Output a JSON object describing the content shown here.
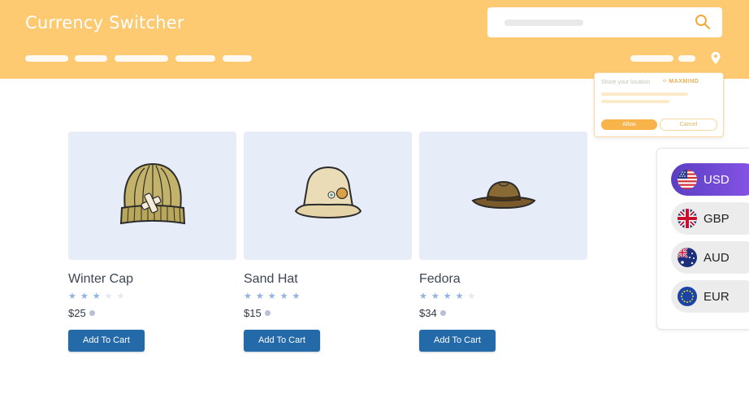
{
  "header": {
    "title": "Currency Switcher",
    "search": {
      "placeholder": ""
    }
  },
  "location_prompt": {
    "text": "Share your location",
    "provider": "MAXMIND",
    "allow_label": "Allow",
    "cancel_label": "Cancel"
  },
  "products": [
    {
      "name": "Winter Cap",
      "rating": 3,
      "max_rating": 5,
      "price": "$25",
      "button_label": "Add To Cart",
      "image_icon": "beanie-icon"
    },
    {
      "name": "Sand Hat",
      "rating": 5,
      "max_rating": 5,
      "price": "$15",
      "button_label": "Add To Cart",
      "image_icon": "bucket-hat-icon"
    },
    {
      "name": "Fedora",
      "rating": 4,
      "max_rating": 5,
      "price": "$34",
      "button_label": "Add To Cart",
      "image_icon": "fedora-icon"
    }
  ],
  "currency_switcher": {
    "selected": "USD",
    "options": [
      {
        "code": "USD",
        "flag": "us-flag-icon"
      },
      {
        "code": "GBP",
        "flag": "uk-flag-icon"
      },
      {
        "code": "AUD",
        "flag": "au-flag-icon"
      },
      {
        "code": "EUR",
        "flag": "eu-flag-icon"
      }
    ]
  },
  "colors": {
    "header": "#fdc971",
    "button": "#2469a8",
    "card_bg": "#e6ecf8",
    "selected_currency": "#6b48d6",
    "star_filled": "#8fb1e3",
    "star_empty": "#e3e7ef"
  }
}
